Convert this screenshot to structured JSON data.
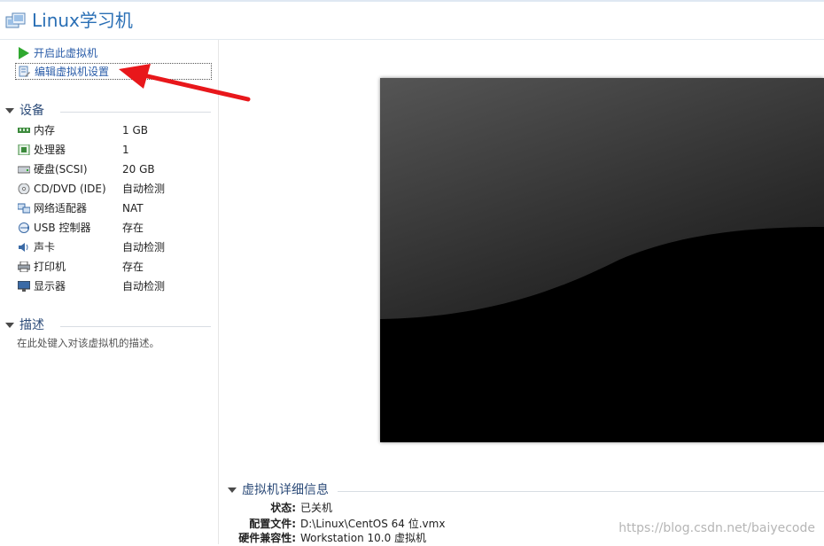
{
  "header": {
    "title": "Linux学习机"
  },
  "actions": {
    "start_label": "开启此虚拟机",
    "edit_label": "编辑虚拟机设置"
  },
  "devices": {
    "title": "设备",
    "items": [
      {
        "name": "内存",
        "value": "1 GB",
        "icon": "memory-icon"
      },
      {
        "name": "处理器",
        "value": "1",
        "icon": "processor-icon"
      },
      {
        "name": "硬盘(SCSI)",
        "value": "20 GB",
        "icon": "hard-disk-icon"
      },
      {
        "name": "CD/DVD (IDE)",
        "value": "自动检测",
        "icon": "cd-dvd-icon"
      },
      {
        "name": "网络适配器",
        "value": "NAT",
        "icon": "network-adapter-icon"
      },
      {
        "name": "USB 控制器",
        "value": "存在",
        "icon": "usb-icon"
      },
      {
        "name": "声卡",
        "value": "自动检测",
        "icon": "sound-card-icon"
      },
      {
        "name": "打印机",
        "value": "存在",
        "icon": "printer-icon"
      },
      {
        "name": "显示器",
        "value": "自动检测",
        "icon": "display-icon"
      }
    ]
  },
  "description": {
    "title": "描述",
    "hint": "在此处键入对该虚拟机的描述。"
  },
  "details": {
    "title": "虚拟机详细信息",
    "rows": [
      {
        "key": "状态:",
        "value": "已关机"
      },
      {
        "key": "配置文件:",
        "value": "D:\\Linux\\CentOS 64 位.vmx"
      },
      {
        "key": "硬件兼容性:",
        "value": "Workstation 10.0 虚拟机"
      }
    ]
  },
  "watermark": "https://blog.csdn.net/baiyecode",
  "colors": {
    "accent": "#2a6fb5",
    "section_title": "#2d4c79",
    "annotation_arrow": "#e8171b"
  }
}
